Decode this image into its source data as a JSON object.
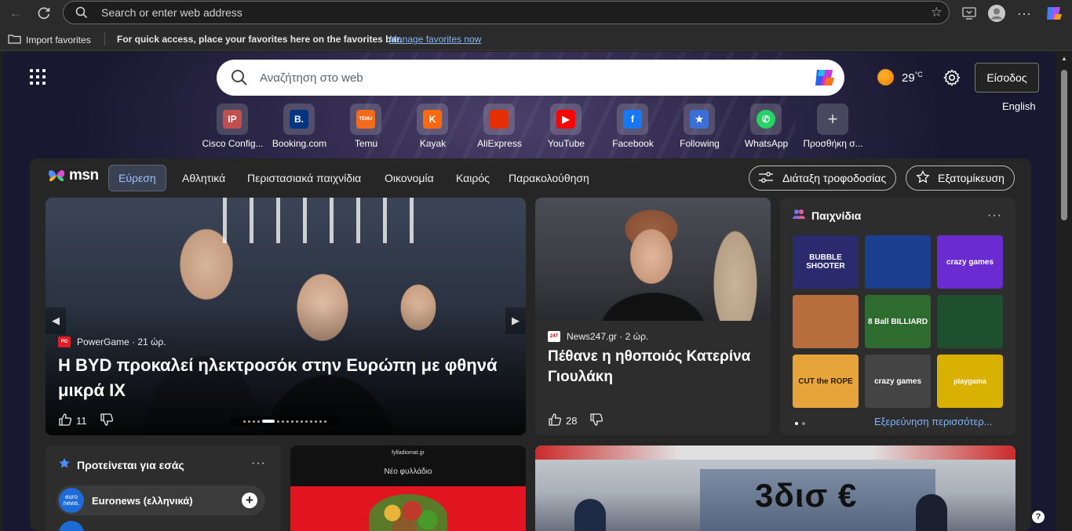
{
  "browser": {
    "address_placeholder": "Search or enter web address"
  },
  "favorites_bar": {
    "import_label": "Import favorites",
    "message": "For quick access, place your favorites here on the favorites bar.",
    "manage_link": "Manage favorites now"
  },
  "newtab": {
    "search_placeholder": "Αναζήτηση στο web",
    "weather_temp": "29",
    "weather_unit": "°C",
    "signin_label": "Είσοδος",
    "language": "English",
    "tiles": [
      {
        "label": "Cisco Config...",
        "logo_text": "IP",
        "color": "#c0504d",
        "icon": "cisco-icon"
      },
      {
        "label": "Booking.com",
        "logo_text": "B.",
        "color": "#003580",
        "icon": "booking-icon"
      },
      {
        "label": "Temu",
        "logo_text": "TEMU",
        "color": "#f26b1d",
        "icon": "temu-icon"
      },
      {
        "label": "Kayak",
        "logo_text": "K",
        "color": "#ff690f",
        "icon": "kayak-icon"
      },
      {
        "label": "AliExpress",
        "logo_text": "",
        "color": "#e62e04",
        "icon": "aliexpress-icon"
      },
      {
        "label": "YouTube",
        "logo_text": "▶",
        "color": "#ff0000",
        "icon": "youtube-icon"
      },
      {
        "label": "Facebook",
        "logo_text": "f",
        "color": "#1877f2",
        "icon": "facebook-icon"
      },
      {
        "label": "Following",
        "logo_text": "★",
        "color": "#3b6fd8",
        "icon": "following-icon"
      },
      {
        "label": "WhatsApp",
        "logo_text": "✆",
        "color": "#25d366",
        "icon": "whatsapp-icon"
      },
      {
        "label": "Προσθήκη σ...",
        "logo_text": "+",
        "color": "transparent",
        "icon": "add-icon"
      }
    ]
  },
  "feed": {
    "brand": "msn",
    "tabs": [
      "Εύρεση",
      "Αθλητικά",
      "Περιστασιακά παιχνίδια",
      "Οικονομία",
      "Καιρός",
      "Παρακολούθηση"
    ],
    "layout_button": "Διάταξη τροφοδοσίας",
    "personalize_button": "Εξατομίκευση",
    "hero": {
      "source": "PowerGame",
      "time": "21 ώρ.",
      "title": "Η BYD προκαλεί ηλεκτροσόκ στην Ευρώπη με φθηνά μικρά ΙΧ",
      "likes": "11"
    },
    "card2": {
      "source": "News247.gr",
      "time": "2 ώρ.",
      "title": "Πέθανε η ηθοποιός Κατερίνα Γιουλάκη",
      "likes": "28"
    },
    "games": {
      "title": "Παιχνίδια",
      "explore": "Εξερεύνηση περισσότερ...",
      "tiles": [
        {
          "text": "BUBBLE SHOOTER",
          "bg": "#2b2a6e",
          "fg": "#ffffff"
        },
        {
          "text": "",
          "bg": "#1c3f8f",
          "fg": "#ffffff"
        },
        {
          "text": "crazy games",
          "bg": "#6a2bd0",
          "fg": "#ffffff"
        },
        {
          "text": "",
          "bg": "#b86d3c",
          "fg": "#ffffff"
        },
        {
          "text": "8 Ball BILLIARD",
          "bg": "#2e6b2e",
          "fg": "#ffffff"
        },
        {
          "text": "",
          "bg": "#1e4f2e",
          "fg": "#ffffff"
        },
        {
          "text": "CUT the ROPE",
          "bg": "#e7a43a",
          "fg": "#2a1a00"
        },
        {
          "text": "crazy games",
          "bg": "#444444",
          "fg": "#ffffff"
        },
        {
          "text": "playgama",
          "bg": "#d9b100",
          "fg": "#ffffff"
        }
      ]
    },
    "recommended": {
      "title": "Προτείνεται για εσάς",
      "item": "Euronews (ελληνικά)",
      "item_logo": "euro news."
    },
    "flyer": {
      "site": "fylladiomat.gr",
      "subtitle": "Νέο φυλλάδιο"
    },
    "tv": {
      "headline": "3δισ €"
    }
  }
}
